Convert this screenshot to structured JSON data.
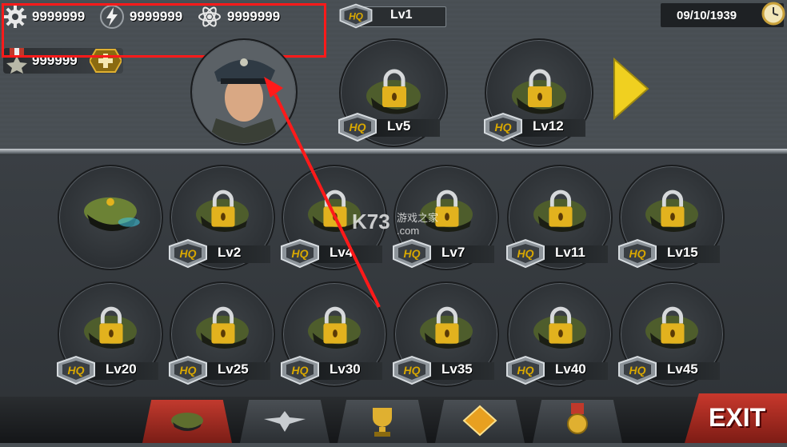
{
  "resources": [
    {
      "icon": "gear-icon",
      "value": "9999999"
    },
    {
      "icon": "lightning-icon",
      "value": "9999999"
    },
    {
      "icon": "atom-icon",
      "value": "9999999"
    }
  ],
  "medals": {
    "icon": "medal-icon",
    "value": "999999"
  },
  "hq": {
    "badge": "HQ",
    "level": "Lv1"
  },
  "date": "09/10/1939",
  "featured_row": [
    {
      "level": "Lv5",
      "locked": true
    },
    {
      "level": "Lv12",
      "locked": true
    }
  ],
  "grid": [
    {
      "level": "",
      "locked": false
    },
    {
      "level": "Lv2",
      "locked": true
    },
    {
      "level": "Lv4",
      "locked": true
    },
    {
      "level": "Lv7",
      "locked": true
    },
    {
      "level": "Lv11",
      "locked": true
    },
    {
      "level": "Lv15",
      "locked": true
    },
    {
      "level": "Lv20",
      "locked": true
    },
    {
      "level": "Lv25",
      "locked": true
    },
    {
      "level": "Lv30",
      "locked": true
    },
    {
      "level": "Lv35",
      "locked": true
    },
    {
      "level": "Lv40",
      "locked": true
    },
    {
      "level": "Lv45",
      "locked": true
    }
  ],
  "tabs": [
    {
      "icon": "cap-icon",
      "active": true
    },
    {
      "icon": "wrench-wings-icon",
      "active": false
    },
    {
      "icon": "trophy-icon",
      "active": false
    },
    {
      "icon": "diamond-icon",
      "active": false
    },
    {
      "icon": "medal-icon",
      "active": false
    }
  ],
  "exit_label": "EXIT",
  "watermark": {
    "main": "K73",
    "sub_cn": "游戏之家",
    "sub_dom": ".com"
  },
  "colors": {
    "annotation_red": "#ff1a1a",
    "badge_gold": "#d9a800",
    "exit_red": "#c8382c"
  }
}
